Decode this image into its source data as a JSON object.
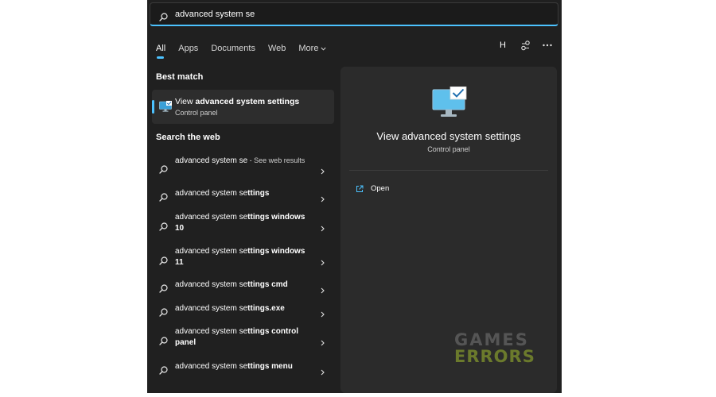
{
  "search": {
    "value": "advanced system se"
  },
  "tabs": [
    {
      "label": "All",
      "active": true
    },
    {
      "label": "Apps"
    },
    {
      "label": "Documents"
    },
    {
      "label": "Web"
    },
    {
      "label": "More",
      "icon": "chevron-down-icon"
    }
  ],
  "toolbar": {
    "avatar_letter": "H",
    "icons": [
      "share-icon",
      "more-icon"
    ]
  },
  "best_match": {
    "section_title": "Best match",
    "title_prefix": "View ",
    "title_match": "advanced system settings",
    "subtitle": "Control panel",
    "icon": "monitor-checkmark-icon"
  },
  "web": {
    "section_title": "Search the web",
    "items": [
      {
        "query": "advanced system se",
        "suffix": " - See web results"
      },
      {
        "query": "advanced system se",
        "rest": "ttings"
      },
      {
        "query": "advanced system se",
        "rest": "ttings windows 10"
      },
      {
        "query": "advanced system se",
        "rest": "ttings windows 11"
      },
      {
        "query": "advanced system se",
        "rest": "ttings cmd"
      },
      {
        "query": "advanced system se",
        "rest": "ttings.exe"
      },
      {
        "query": "advanced system se",
        "rest": "ttings control panel"
      },
      {
        "query": "advanced system se",
        "rest": "ttings menu"
      }
    ]
  },
  "detail": {
    "title": "View advanced system settings",
    "subtitle": "Control panel",
    "action_label": "Open",
    "action_icon": "open-external-icon"
  },
  "watermark": {
    "line1": "GAMES",
    "line2": "ERRORS"
  },
  "colors": {
    "accent": "#4cc2ff",
    "panel_bg": "#202020",
    "detail_bg": "#2b2b2b",
    "watermark_green": "#6b7a2c"
  }
}
